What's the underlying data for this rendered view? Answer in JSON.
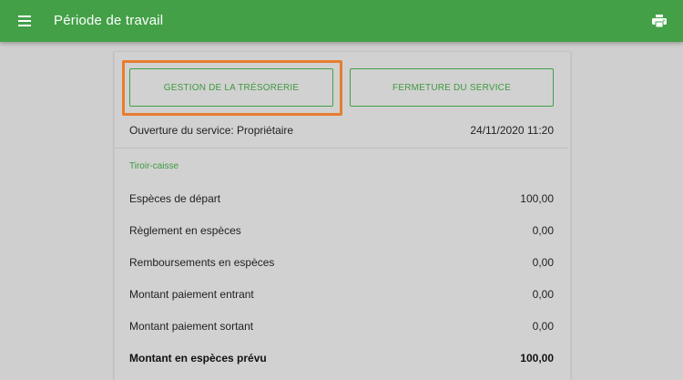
{
  "appbar": {
    "title": "Période de travail",
    "menu_icon": "menu-icon",
    "print_icon": "print-icon",
    "color": "#43a047"
  },
  "buttons": {
    "gestion_label": "GESTION DE LA TRÉSORERIE",
    "fermeture_label": "FERMETURE DU SERVICE",
    "highlight_color": "#e67e30"
  },
  "service": {
    "opening_label": "Ouverture du service: Propriétaire",
    "opening_datetime": "24/11/2020 11:20"
  },
  "cash_drawer": {
    "title": "Tiroir-caisse",
    "rows": [
      {
        "label": "Espèces de départ",
        "value": "100,00"
      },
      {
        "label": "Règlement en espèces",
        "value": "0,00"
      },
      {
        "label": "Remboursements en espèces",
        "value": "0,00"
      },
      {
        "label": "Montant paiement entrant",
        "value": "0,00"
      },
      {
        "label": "Montant paiement sortant",
        "value": "0,00"
      },
      {
        "label": "Montant en espèces prévu",
        "value": "100,00"
      }
    ]
  }
}
